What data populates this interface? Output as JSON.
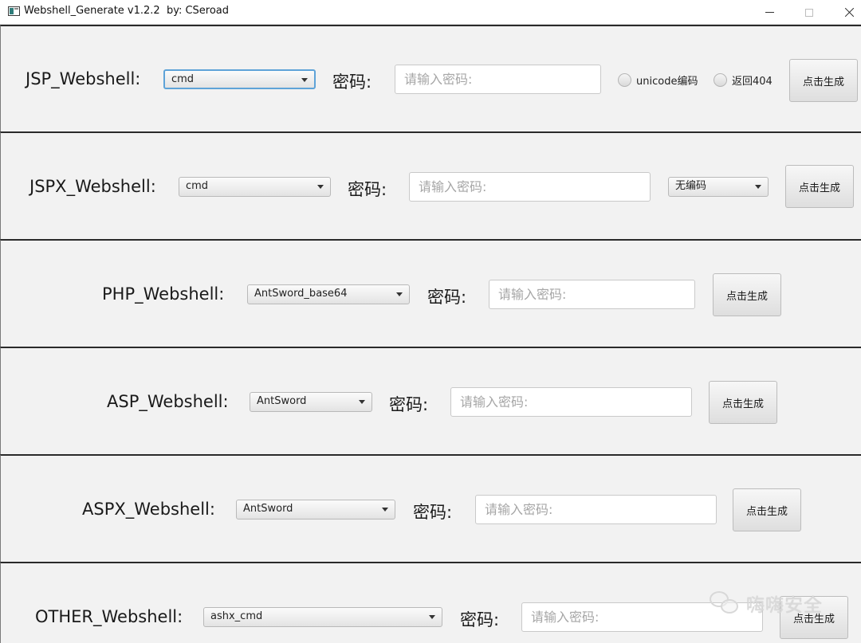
{
  "window": {
    "title": "Webshell_Generate v1.2.2  by: CSeroad"
  },
  "common": {
    "password_label": "密码:",
    "password_placeholder": "请输入密码:",
    "generate_label": "点击生成"
  },
  "sections": {
    "jsp": {
      "label": "JSP_Webshell:",
      "type_selected": "cmd",
      "unicode_label": "unicode编码",
      "return404_label": "返回404"
    },
    "jspx": {
      "label": "JSPX_Webshell:",
      "type_selected": "cmd",
      "encoding_selected": "无编码"
    },
    "php": {
      "label": "PHP_Webshell:",
      "type_selected": "AntSword_base64"
    },
    "asp": {
      "label": "ASP_Webshell:",
      "type_selected": "AntSword"
    },
    "aspx": {
      "label": "ASPX_Webshell:",
      "type_selected": "AntSword"
    },
    "other": {
      "label": "OTHER_Webshell:",
      "type_selected": "ashx_cmd"
    }
  },
  "watermark": {
    "text": "嗨嗨安全",
    "icon": "wechat-icon"
  }
}
